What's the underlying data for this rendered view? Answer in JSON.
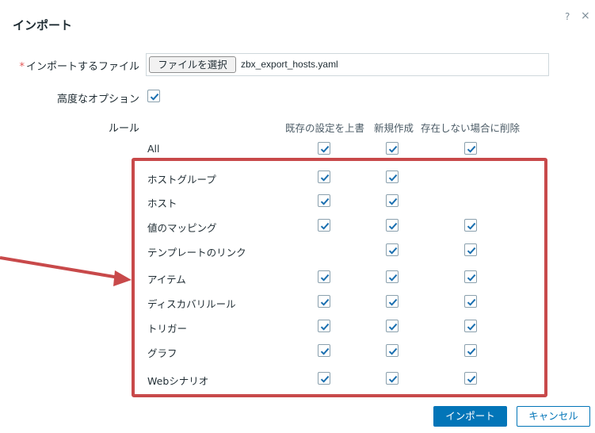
{
  "dialog": {
    "title": "インポート",
    "help": "?",
    "close": "×"
  },
  "form": {
    "file_label_star": "*",
    "file_label": "インポートするファイル",
    "file_button": "ファイルを選択",
    "file_name": "zbx_export_hosts.yaml",
    "advanced_label": "高度なオプション",
    "advanced_checked": true,
    "rules_label": "ルール"
  },
  "rules": {
    "columns": [
      "既存の設定を上書",
      "新規作成",
      "存在しない場合に削除"
    ],
    "rows": [
      {
        "name": "All",
        "update": true,
        "create": true,
        "delete": true
      },
      {
        "name": "ホストグループ",
        "update": true,
        "create": true,
        "delete": null
      },
      {
        "name": "ホスト",
        "update": true,
        "create": true,
        "delete": null
      },
      {
        "name": "値のマッピング",
        "update": true,
        "create": true,
        "delete": true
      },
      {
        "name": "テンプレートのリンク",
        "update": null,
        "create": true,
        "delete": true
      },
      {
        "name": "アイテム",
        "update": true,
        "create": true,
        "delete": true
      },
      {
        "name": "ディスカバリルール",
        "update": true,
        "create": true,
        "delete": true
      },
      {
        "name": "トリガー",
        "update": true,
        "create": true,
        "delete": true
      },
      {
        "name": "グラフ",
        "update": true,
        "create": true,
        "delete": true
      },
      {
        "name": "Webシナリオ",
        "update": true,
        "create": true,
        "delete": true
      }
    ]
  },
  "footer": {
    "import_button": "インポート",
    "cancel_button": "キャンセル"
  },
  "colors": {
    "primary": "#0275b8",
    "highlight": "#c8494a",
    "check": "#1a6fb0"
  }
}
